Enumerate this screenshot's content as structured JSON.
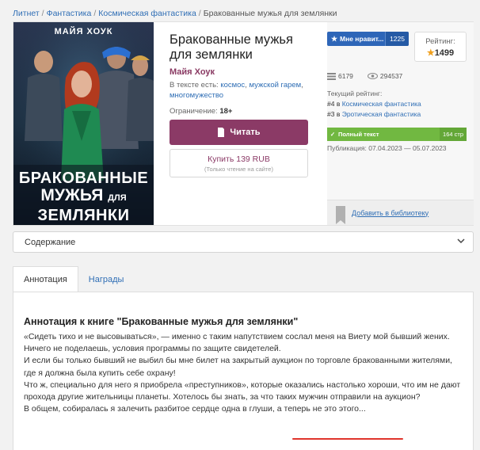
{
  "breadcrumb": {
    "items": [
      "Литнет",
      "Фантастика",
      "Космическая фантастика"
    ],
    "separator": "/",
    "current": "Бракованные мужья для землянки"
  },
  "cover": {
    "author": "МАЙЯ ХОУК",
    "title_line1": "БРАКОВАННЫЕ",
    "title_line2": "МУЖЬЯ",
    "title_small": "ДЛЯ",
    "title_line3": "ЗЕМЛЯНКИ"
  },
  "book": {
    "title": "Бракованные мужья для землянки",
    "author": "Майя Хоук",
    "tags_label": "В тексте есть:",
    "tags": [
      "космос",
      "мужской гарем",
      "многомужество"
    ],
    "age_label": "Ограничение:",
    "age_value": "18+"
  },
  "actions": {
    "read_label": "Читать",
    "buy_label": "Купить 139 RUB",
    "buy_sub": "(Только чтение на сайте)",
    "add_library": "Добавить в библиотеку"
  },
  "stats": {
    "like_label": "Мне нравит...",
    "like_count": "1225",
    "rating_label": "Рейтинг:",
    "rating_value": "1499",
    "books_count": "6179",
    "views_count": "294537",
    "current_rating_label": "Текущий рейтинг:",
    "rank1_prefix": "#4 в",
    "rank1_cat": "Космическая фантастика",
    "rank2_prefix": "#3 в",
    "rank2_cat": "Эротическая фантастика",
    "fulltext_label": "Полный текст",
    "pages": "164 стр",
    "published": "Публикация: 07.04.2023 — 05.07.2023"
  },
  "contents_select": "Содержание",
  "tabs": [
    "Аннотация",
    "Награды"
  ],
  "annotation": {
    "heading": "Аннотация к книге \"Бракованные мужья для землянки\"",
    "lines": [
      "«Сидеть тихо и не высовываться», — именно с таким напутствием сослал меня на Виету мой бывший жених. Ничего не поделаешь, условия программы по защите свидетелей.",
      "И если бы только бывший не выбил бы мне билет на закрытый аукцион по торговле бракованными жителями, где я должна была купить себе охрану!",
      "Что ж, специально для него я приобрела «преступников», которые оказались настолько хороши, что им не дают прохода другие жительницы планеты. Хотелось бы знать, за что таких мужчин отправили на аукцион?",
      "В общем, собиралась я залечить разбитое сердце одна в глуши, а теперь не это этого..."
    ]
  },
  "colors": {
    "accent": "#8b3a66",
    "link": "#2f6eb5",
    "like": "#2e66b8",
    "fulltext": "#71b841",
    "underline": "#e0342c"
  }
}
